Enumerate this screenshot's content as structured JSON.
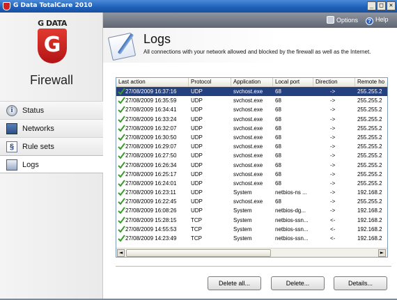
{
  "window": {
    "title": "G Data TotalCare 2010",
    "controls": {
      "minimize": "_",
      "maximize": "□",
      "close": "✕"
    }
  },
  "sidebar": {
    "brand": "G DATA",
    "brand_letter": "G",
    "module_title": "Firewall",
    "items": [
      {
        "label": "Status",
        "icon": "info-icon",
        "glyph": "i",
        "active": false
      },
      {
        "label": "Networks",
        "icon": "network-icon",
        "active": false
      },
      {
        "label": "Rule sets",
        "icon": "rules-icon",
        "glyph": "§",
        "active": false
      },
      {
        "label": "Logs",
        "icon": "logs-icon",
        "active": true
      }
    ]
  },
  "header": {
    "options_label": "Options",
    "help_label": "Help",
    "help_glyph": "?"
  },
  "section": {
    "title": "Logs",
    "description": "All connections with your network allowed and blocked by the firewall as well as the Internet."
  },
  "grid": {
    "columns": [
      "Last action",
      "Protocol",
      "Application",
      "Local port",
      "Direction",
      "Remote ho"
    ],
    "selected_index": 0,
    "rows": [
      {
        "last_action": "27/08/2009 16:37:16",
        "protocol": "UDP",
        "application": "svchost.exe",
        "local_port": "68",
        "direction": "->",
        "remote": "255.255.2"
      },
      {
        "last_action": "27/08/2009 16:35:59",
        "protocol": "UDP",
        "application": "svchost.exe",
        "local_port": "68",
        "direction": "->",
        "remote": "255.255.2"
      },
      {
        "last_action": "27/08/2009 16:34:41",
        "protocol": "UDP",
        "application": "svchost.exe",
        "local_port": "68",
        "direction": "->",
        "remote": "255.255.2"
      },
      {
        "last_action": "27/08/2009 16:33:24",
        "protocol": "UDP",
        "application": "svchost.exe",
        "local_port": "68",
        "direction": "->",
        "remote": "255.255.2"
      },
      {
        "last_action": "27/08/2009 16:32:07",
        "protocol": "UDP",
        "application": "svchost.exe",
        "local_port": "68",
        "direction": "->",
        "remote": "255.255.2"
      },
      {
        "last_action": "27/08/2009 16:30:50",
        "protocol": "UDP",
        "application": "svchost.exe",
        "local_port": "68",
        "direction": "->",
        "remote": "255.255.2"
      },
      {
        "last_action": "27/08/2009 16:29:07",
        "protocol": "UDP",
        "application": "svchost.exe",
        "local_port": "68",
        "direction": "->",
        "remote": "255.255.2"
      },
      {
        "last_action": "27/08/2009 16:27:50",
        "protocol": "UDP",
        "application": "svchost.exe",
        "local_port": "68",
        "direction": "->",
        "remote": "255.255.2"
      },
      {
        "last_action": "27/08/2009 16:26:34",
        "protocol": "UDP",
        "application": "svchost.exe",
        "local_port": "68",
        "direction": "->",
        "remote": "255.255.2"
      },
      {
        "last_action": "27/08/2009 16:25:17",
        "protocol": "UDP",
        "application": "svchost.exe",
        "local_port": "68",
        "direction": "->",
        "remote": "255.255.2"
      },
      {
        "last_action": "27/08/2009 16:24:01",
        "protocol": "UDP",
        "application": "svchost.exe",
        "local_port": "68",
        "direction": "->",
        "remote": "255.255.2"
      },
      {
        "last_action": "27/08/2009 16:23:11",
        "protocol": "UDP",
        "application": "System",
        "local_port": "netbios-ns ...",
        "direction": "->",
        "remote": "192.168.2"
      },
      {
        "last_action": "27/08/2009 16:22:45",
        "protocol": "UDP",
        "application": "svchost.exe",
        "local_port": "68",
        "direction": "->",
        "remote": "255.255.2"
      },
      {
        "last_action": "27/08/2009 16:08:26",
        "protocol": "UDP",
        "application": "System",
        "local_port": "netbios-dg...",
        "direction": "->",
        "remote": "192.168.2"
      },
      {
        "last_action": "27/08/2009 15:28:15",
        "protocol": "TCP",
        "application": "System",
        "local_port": "netbios-ssn...",
        "direction": "<-",
        "remote": "192.168.2"
      },
      {
        "last_action": "27/08/2009 14:55:53",
        "protocol": "TCP",
        "application": "System",
        "local_port": "netbios-ssn...",
        "direction": "<-",
        "remote": "192.168.2"
      },
      {
        "last_action": "27/08/2009 14:23:49",
        "protocol": "TCP",
        "application": "System",
        "local_port": "netbios-ssn...",
        "direction": "<-",
        "remote": "192.168.2"
      }
    ],
    "scroll_left": "◄",
    "scroll_right": "►"
  },
  "buttons": {
    "delete_all": "Delete all...",
    "delete": "Delete...",
    "details": "Details..."
  },
  "colors": {
    "titlebar": "#1f5fb8",
    "selection": "#24407f",
    "brand_red": "#d21f1f",
    "check_green": "#3a9a2a"
  }
}
